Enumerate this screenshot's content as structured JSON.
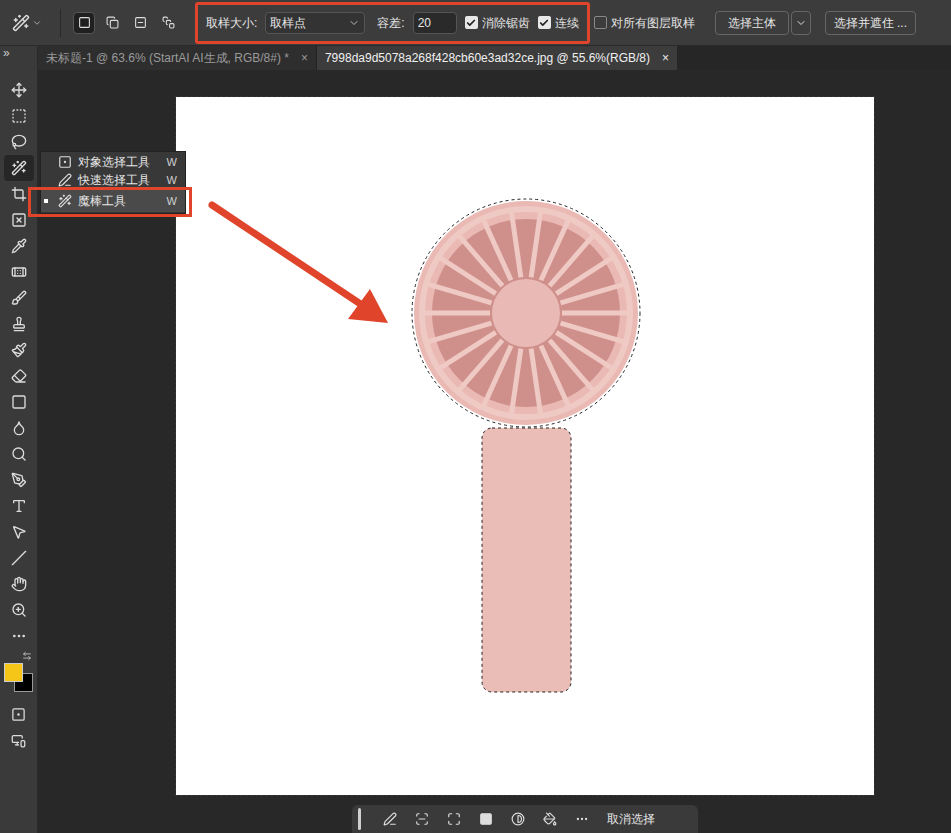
{
  "options_bar": {
    "sample_size_label": "取样大小:",
    "sample_size_value": "取样点",
    "tolerance_label": "容差:",
    "tolerance_value": "20",
    "anti_alias": {
      "label": "消除锯齿",
      "checked": true
    },
    "contiguous": {
      "label": "连续",
      "checked": true
    },
    "sample_all_layers": {
      "label": "对所有图层取样",
      "checked": false
    },
    "select_subject": "选择主体",
    "select_and_mask": "选择并遮住 ...",
    "selection_modes": [
      {
        "selected": true
      },
      {
        "selected": false
      },
      {
        "selected": false
      },
      {
        "selected": false
      }
    ]
  },
  "panel_toggle": "»",
  "tabs": [
    {
      "label": "未标题-1 @ 63.6% (StartAI AI生成, RGB/8#) *",
      "selected": false,
      "close": "×"
    },
    {
      "label": "7998da9d5078a268f428cb60e3ad32ce.jpg @ 55.6%(RGB/8)",
      "selected": true,
      "close": "×"
    }
  ],
  "tool_flyout": [
    {
      "label": "对象选择工具",
      "shortcut": "W",
      "selected": false
    },
    {
      "label": "快速选择工具",
      "shortcut": "W",
      "selected": false
    },
    {
      "label": "魔棒工具",
      "shortcut": "W",
      "selected": true
    }
  ],
  "swatches": {
    "foreground": "#f5c518",
    "background": "#000000"
  },
  "task_bar": {
    "deselect": "取消选择"
  }
}
